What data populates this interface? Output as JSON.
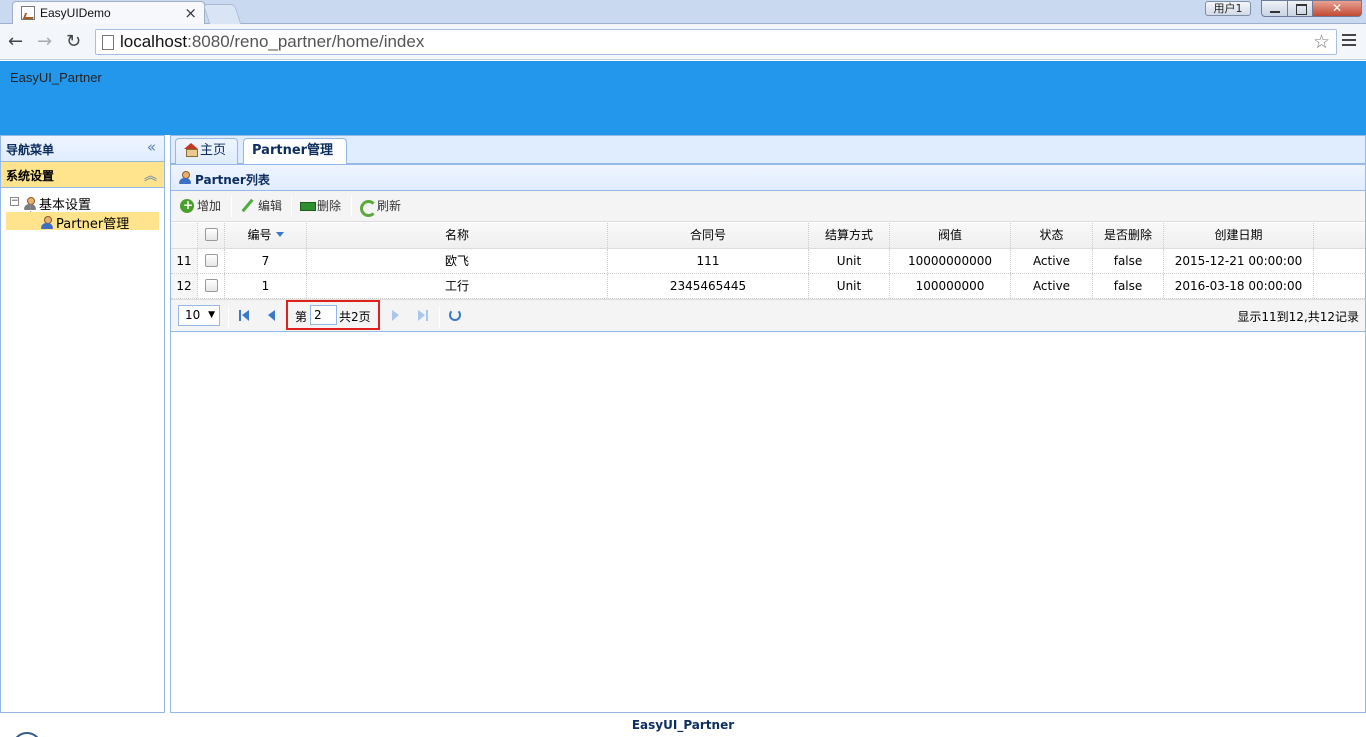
{
  "browser": {
    "tab_title": "EasyUIDemo",
    "tab_close": "×",
    "ghost_tab_text": "         ",
    "user_badge": "用户1",
    "close_btn": "✕",
    "url_host": "localhost",
    "url_path": ":8080/reno_partner/home/index",
    "back_icon": "←",
    "forward_icon": "→",
    "reload_icon": "↻",
    "star_icon": "☆"
  },
  "app": {
    "brand": "EasyUI_Partner",
    "footer": "EasyUI_Partner"
  },
  "west": {
    "title": "导航菜单",
    "collapse_icon": "«",
    "accordion_title": "系统设置",
    "accordion_toggle": "︽",
    "tree": {
      "expander": "−",
      "parent": "基本设置",
      "child": "Partner管理"
    }
  },
  "center": {
    "tabs": [
      {
        "label": "主页"
      },
      {
        "label": "Partner管理",
        "close": "×"
      }
    ],
    "panel_title": "Partner列表",
    "toolbar": {
      "add": "增加",
      "edit": "编辑",
      "delete": "删除",
      "refresh": "刷新"
    },
    "grid": {
      "columns": [
        "编号",
        "名称",
        "合同号",
        "结算方式",
        "阀值",
        "状态",
        "是否删除",
        "创建日期"
      ],
      "rows": [
        {
          "rownum": "11",
          "id": "7",
          "name": "欧飞",
          "contract": "111",
          "settle": "Unit",
          "threshold": "10000000000",
          "status": "Active",
          "deleted": "false",
          "created": "2015-12-21 00:00:00"
        },
        {
          "rownum": "12",
          "id": "1",
          "name": "工行",
          "contract": "2345465445",
          "settle": "Unit",
          "threshold": "100000000",
          "status": "Active",
          "deleted": "false",
          "created": "2016-03-18 00:00:00"
        }
      ]
    },
    "pager": {
      "page_size": "10",
      "page_size_arrow": "▼",
      "page_prefix": "第",
      "page_value": "2",
      "page_total": "共2页",
      "info": "显示11到12,共12记录"
    }
  },
  "colors": {
    "header_blue": "#2397eb",
    "border_blue": "#95b8e7",
    "selected_yellow": "#ffe48d",
    "highlight_red": "#e0201b"
  }
}
